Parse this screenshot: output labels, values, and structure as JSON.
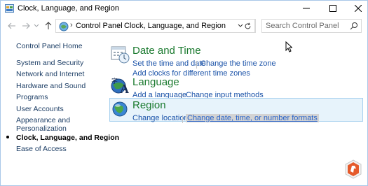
{
  "window": {
    "title": "Clock, Language, and Region"
  },
  "address": {
    "crumbs": [
      "Control Panel",
      "Clock, Language, and Region"
    ]
  },
  "search": {
    "placeholder": "Search Control Panel"
  },
  "leftnav": {
    "home": "Control Panel Home",
    "items": [
      "System and Security",
      "Network and Internet",
      "Hardware and Sound",
      "Programs",
      "User Accounts",
      "Appearance and",
      "Personalization",
      "Clock, Language, and Region",
      "Ease of Access"
    ]
  },
  "categories": {
    "datetime": {
      "title": "Date and Time",
      "links": [
        "Set the time and date",
        "Change the time zone",
        "Add clocks for different time zones"
      ]
    },
    "language": {
      "title": "Language",
      "links": [
        "Add a language",
        "Change input methods"
      ]
    },
    "region": {
      "title": "Region",
      "links": [
        "Change location",
        "Change date, time, or number formats"
      ]
    }
  },
  "colors": {
    "accent_link": "#1a52a8",
    "category_title": "#1b7a2f",
    "highlight_bg": "#e7f3fb"
  }
}
